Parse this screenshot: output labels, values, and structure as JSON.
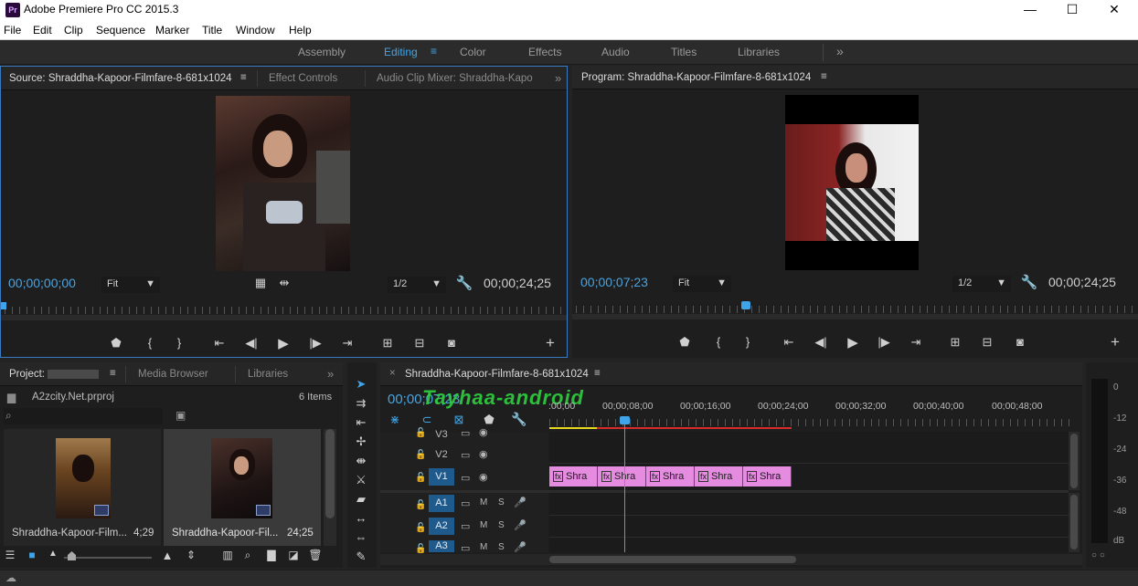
{
  "window": {
    "title": "Adobe Premiere Pro CC 2015.3",
    "icon_text": "Pr",
    "controls": [
      "—",
      "☐",
      "✕"
    ]
  },
  "menu": [
    "File",
    "Edit",
    "Clip",
    "Sequence",
    "Marker",
    "Title",
    "Window",
    "Help"
  ],
  "workspaces": [
    {
      "label": "Assembly"
    },
    {
      "label": "Editing",
      "active": true
    },
    {
      "label": "Color"
    },
    {
      "label": "Effects"
    },
    {
      "label": "Audio"
    },
    {
      "label": "Titles"
    },
    {
      "label": "Libraries"
    }
  ],
  "source_panel": {
    "tabs": [
      "Source: Shraddha-Kapoor-Filmfare-8-681x1024",
      "Effect Controls",
      "Audio Clip Mixer: Shraddha-Kapo"
    ],
    "timecode_in": "00;00;00;00",
    "fit": "Fit",
    "resolution": "1/2",
    "timecode_duration": "00;00;24;25"
  },
  "program_panel": {
    "tab": "Program: Shraddha-Kapoor-Filmfare-8-681x1024",
    "timecode_in": "00;00;07;23",
    "fit": "Fit",
    "resolution": "1/2",
    "timecode_duration": "00;00;24;25"
  },
  "project_panel": {
    "tabs": [
      "Project:",
      "Media Browser",
      "Libraries"
    ],
    "project_file": "A2zcity.Net.prproj",
    "items_count": "6 Items",
    "items": [
      {
        "name": "Shraddha-Kapoor-Film...",
        "duration": "4;29"
      },
      {
        "name": "Shraddha-Kapoor-Fil...",
        "duration": "24;25"
      }
    ]
  },
  "timeline": {
    "sequence_tab": "Shraddha-Kapoor-Filmfare-8-681x1024",
    "timecode": "00;00;07;23",
    "watermark": "Tayhaa-android",
    "ruler_labels": [
      ":00;00",
      "00;00;08;00",
      "00;00;16;00",
      "00;00;24;00",
      "00;00;32;00",
      "00;00;40;00",
      "00;00;48;00"
    ],
    "video_tracks": [
      "V3",
      "V2",
      "V1"
    ],
    "audio_tracks": [
      "A1",
      "A2",
      "A3"
    ],
    "mute_label": "M",
    "solo_label": "S",
    "clips": [
      {
        "label": "fx",
        "text": "Shra"
      },
      {
        "label": "fx",
        "text": "Shra"
      },
      {
        "label": "fx",
        "text": "Shra"
      },
      {
        "label": "fx",
        "text": "Shra"
      },
      {
        "label": "fx",
        "text": "Shra"
      }
    ]
  },
  "meter": {
    "labels": [
      "0",
      "-12",
      "-24",
      "-36",
      "-48",
      "dB"
    ],
    "solo_buttons": "○ ○"
  },
  "colors": {
    "accent": "#3fa5e8",
    "clip": "#e58be0",
    "playhead": "#3fa5e8"
  }
}
